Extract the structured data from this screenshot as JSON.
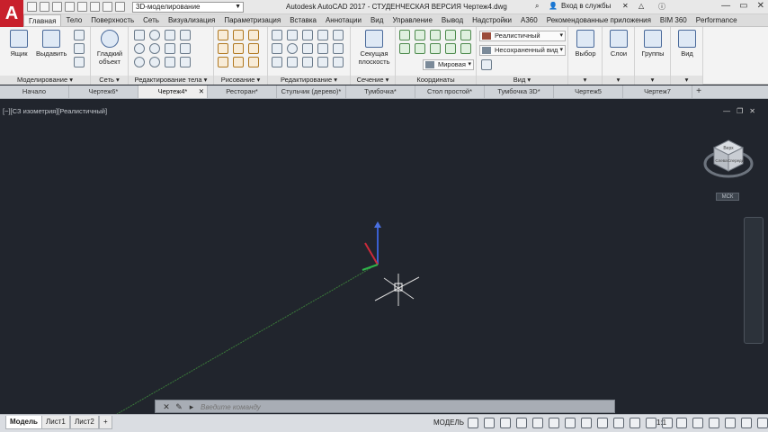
{
  "logo": "A",
  "workspace": "3D-моделирование",
  "app_title": "Autodesk AutoCAD 2017 - СТУДЕНЧЕСКАЯ ВЕРСИЯ    Чертеж4.dwg",
  "signin": "Вход в службы",
  "ribbon_tabs": [
    "Главная",
    "Тело",
    "Поверхность",
    "Сеть",
    "Визуализация",
    "Параметризация",
    "Вставка",
    "Аннотации",
    "Вид",
    "Управление",
    "Вывод",
    "Надстройки",
    "A360",
    "Рекомендованные приложения",
    "BIM 360",
    "Performance"
  ],
  "active_ribbon_tab": 0,
  "panels": {
    "modeling": {
      "label": "Моделирование ▾",
      "box": "Ящик",
      "extrude": "Выдавить"
    },
    "mesh": {
      "label": "Сеть ▾",
      "smooth": "Гладкий объект"
    },
    "solid_edit": {
      "label": "Редактирование тела ▾"
    },
    "draw": {
      "label": "Рисование ▾"
    },
    "modify": {
      "label": "Редактирование ▾"
    },
    "section": {
      "label": "Сечение ▾",
      "plane": "Секущая плоскость"
    },
    "coords": {
      "label": "Координаты",
      "world": "Мировая"
    },
    "view": {
      "label": "Вид ▾",
      "style": "Реалистичный",
      "named": "Несохраненный вид"
    },
    "select": {
      "label": "Выбор"
    },
    "layers": {
      "label": "Слои"
    },
    "groups": {
      "label": "Группы"
    },
    "view2": {
      "label": "Вид"
    }
  },
  "file_tabs": [
    "Начало",
    "Чертеж6*",
    "Чертеж4*",
    "Ресторан*",
    "Стульчик (дерево)*",
    "Тумбочка*",
    "Стол простой*",
    "Тумбочка 3D*",
    "Чертеж5",
    "Чертеж7"
  ],
  "active_file_tab": 2,
  "viewport_label": "[−][СЗ изометрия][Реалистичный]",
  "wcs_label": "МСК",
  "viewcube": {
    "top": "Верх",
    "front": "Спереди",
    "left": "Слева"
  },
  "command_placeholder": "Введите команду",
  "layout_tabs": [
    "Модель",
    "Лист1",
    "Лист2"
  ],
  "active_layout_tab": 0,
  "status": {
    "model": "МОДЕЛЬ",
    "scale": "1:1"
  }
}
